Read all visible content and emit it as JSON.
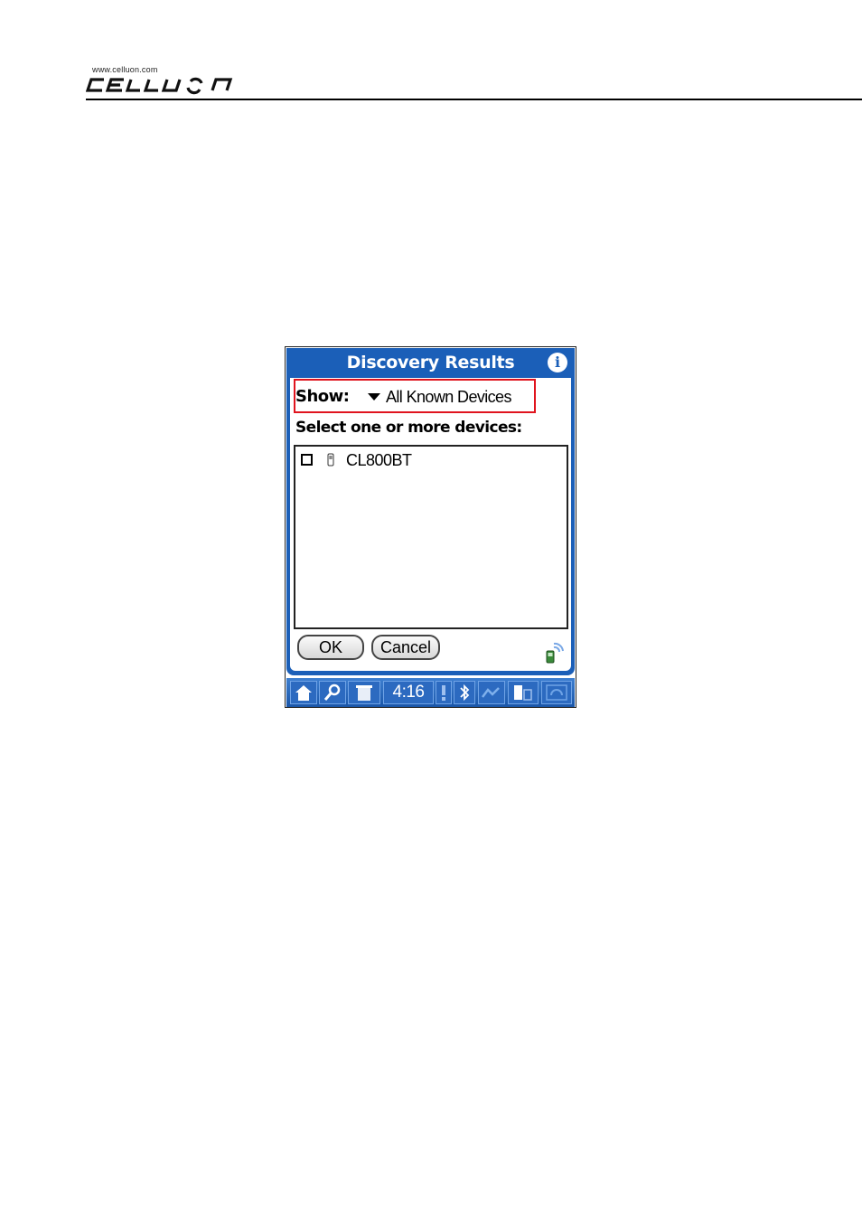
{
  "header": {
    "logo_url": "www.celluon.com",
    "logo_text": "CELLUON"
  },
  "dialog": {
    "title": "Discovery Results",
    "info_icon": "info-icon",
    "show_label": "Show:",
    "show_value": "All Known Devices",
    "select_prompt": "Select one or more devices:",
    "devices": [
      {
        "name": "CL800BT",
        "checked": false,
        "icon": "phone-icon"
      }
    ],
    "ok_label": "OK",
    "cancel_label": "Cancel"
  },
  "statusbar": {
    "time": "4:16",
    "icons": [
      "home-icon",
      "find-icon",
      "menu-icon",
      "alert-icon",
      "bluetooth-icon",
      "signal-icon",
      "device-icon",
      "phone-icon"
    ]
  },
  "colors": {
    "title_bar": "#1b5fb8",
    "highlight": "#e0141e",
    "statusbar": "#2c6ac0"
  }
}
